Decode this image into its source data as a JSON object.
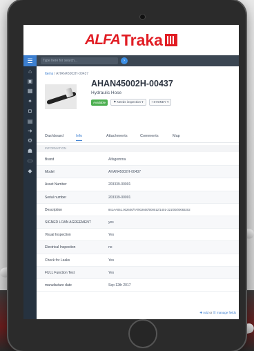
{
  "brand": {
    "alfa": "ALFA",
    "traka": "Traka"
  },
  "search": {
    "placeholder": "Type here for search..."
  },
  "breadcrumb": {
    "link": "Items",
    "current": "AHAN45002H-00437"
  },
  "asset": {
    "title": "AHAN45002H-00437",
    "subtitle": "Hydraulic Hose",
    "status": "Available",
    "inspection": "Needs inspection",
    "location": "SYDNEY"
  },
  "tabs": [
    "Dashboard",
    "Info",
    "Attachments",
    "Comments",
    "Map"
  ],
  "active_tab": "Info",
  "section_title": "INFORMATION",
  "fields": [
    {
      "label": "Brand",
      "value": "Alfagomma"
    },
    {
      "label": "Model",
      "value": "AHAN45002H-00437"
    },
    {
      "label": "Asset Number",
      "value": "203339-00001"
    },
    {
      "label": "Serial number",
      "value": "203339-00001"
    },
    {
      "label": "Description",
      "value": "841AA051.002600/TA/002600/000012/1401-321/00/00083202"
    },
    {
      "label": "SIGNED LOAN AGREEMENT",
      "value": "yes"
    },
    {
      "label": "Visual Inspection",
      "value": "Yes"
    },
    {
      "label": "Electrical Inspection",
      "value": "no"
    },
    {
      "label": "Check for Leaks",
      "value": "Yes"
    },
    {
      "label": "FULL Function Test",
      "value": "Yes"
    },
    {
      "label": "manufacture date",
      "value": "Sep 12th 2017"
    }
  ],
  "footer": {
    "add": "Add",
    "or": "or",
    "manage": "manage fields"
  },
  "colors": {
    "accent": "#3c7fd0",
    "brand": "#e11d24",
    "sidebar": "#26323f",
    "status": "#4caf50"
  }
}
